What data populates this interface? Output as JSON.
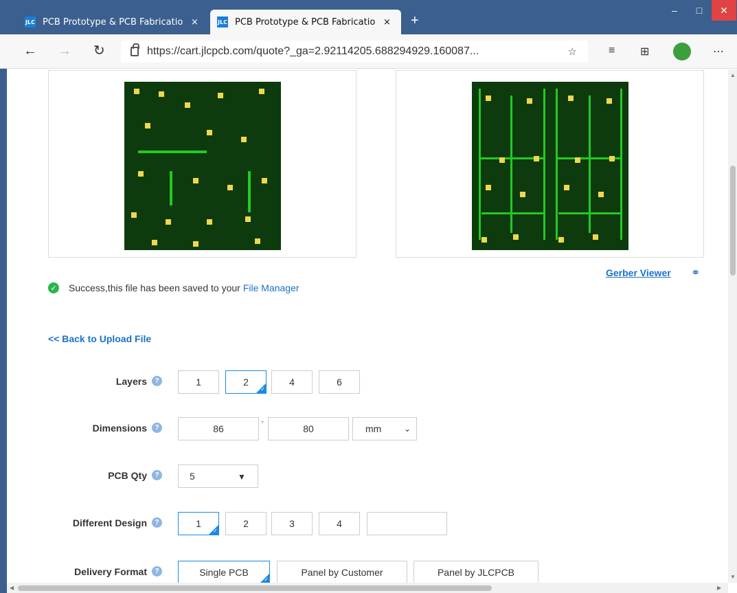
{
  "browser": {
    "tabs": [
      {
        "favicon": "JLC",
        "title": "PCB Prototype & PCB Fabricatio",
        "close": "×"
      },
      {
        "favicon": "JLC",
        "title": "PCB Prototype & PCB Fabricatio",
        "close": "×"
      }
    ],
    "new_tab": "+",
    "url": "https://cart.jlcpcb.com/quote?_ga=2.92114205.688294929.160087...",
    "window_buttons": {
      "minimize": "–",
      "maximize": "□",
      "close": "✕"
    },
    "icons": [
      "back-arrow-icon",
      "forward-arrow-icon",
      "refresh-icon",
      "lock-icon",
      "favorite-star-icon",
      "favorites-icon",
      "collections-icon",
      "profile-avatar",
      "more-icon"
    ]
  },
  "page": {
    "gerber_viewer": "Gerber Viewer",
    "success_text": "Success,this file has been saved to your",
    "file_manager": "File Manager",
    "back_link": "<< Back to Upload File",
    "form": {
      "layers": {
        "label": "Layers",
        "options": [
          "1",
          "2",
          "4",
          "6"
        ],
        "selected": "2"
      },
      "dimensions": {
        "label": "Dimensions",
        "width": "86",
        "height": "80",
        "unit": "mm",
        "separator": "*"
      },
      "pcb_qty": {
        "label": "PCB Qty",
        "value": "5"
      },
      "different_design": {
        "label": "Different Design",
        "options": [
          "1",
          "2",
          "3",
          "4"
        ],
        "selected": "1",
        "custom": ""
      },
      "delivery_format": {
        "label": "Delivery Format",
        "options": [
          "Single PCB",
          "Panel by Customer",
          "Panel by JLCPCB"
        ],
        "selected": "Single PCB"
      }
    }
  },
  "colors": {
    "accent": "#1a8ae6",
    "link": "#1a72c9",
    "pcb_bg": "#0d3b0d",
    "trace": "#25c825",
    "pad": "#f0d84a",
    "titlebar": "#3b5f8e"
  }
}
